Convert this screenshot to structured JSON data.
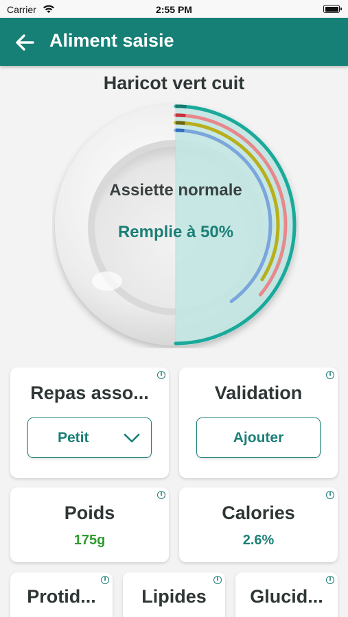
{
  "status_bar": {
    "carrier": "Carrier",
    "time": "2:55 PM"
  },
  "app_bar": {
    "title": "Aliment saisie",
    "back_icon": "arrow-left-icon"
  },
  "food": {
    "name": "Haricot vert cuit"
  },
  "plate": {
    "type_label": "Assiette normale",
    "fill_label": "Remplie à 50%",
    "fill_fraction": 0.5,
    "fill_color": "#c2e6e3",
    "nutrient_arcs": [
      {
        "color": "#1aa99a",
        "fraction": 0.5
      },
      {
        "color": "#e8888c",
        "fraction": 0.36
      },
      {
        "color": "#b9ae1c",
        "fraction": 0.34
      },
      {
        "color": "#7aa6dc",
        "fraction": 0.4
      }
    ],
    "arc_start_colors": [
      "#157a70",
      "#c8323a",
      "#6c6a10",
      "#2f6fc0"
    ]
  },
  "cards": {
    "repas": {
      "title": "Repas asso...",
      "select_value": "Petit",
      "select_icon": "chevron-down-icon"
    },
    "validation": {
      "title": "Validation",
      "button_label": "Ajouter"
    },
    "poids": {
      "title": "Poids",
      "value": "175g",
      "value_color": "#2f9a2f"
    },
    "calories": {
      "title": "Calories",
      "value": "2.6%",
      "value_color": "#1a7f76"
    },
    "protides": {
      "title": "Protid..."
    },
    "lipides": {
      "title": "Lipides"
    },
    "glucides": {
      "title": "Glucid..."
    }
  },
  "colors": {
    "primary": "#167f76",
    "background": "#f3f3f3"
  }
}
